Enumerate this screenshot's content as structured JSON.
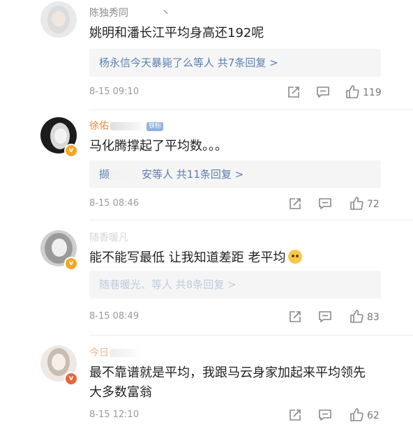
{
  "comments": [
    {
      "username": "陈独秀同",
      "username_suffix": "丶",
      "text": "姚明和潘长江平均身高还192呢",
      "reply_summary": "杨永信今天暴毙了么等人  共7条回复 >",
      "time": "8-15 09:10",
      "likes": "119"
    },
    {
      "username": "徐佑",
      "username_badge": "铁粉",
      "text": "马化腾撑起了平均数。。。",
      "reply_summary_a": "撷",
      "reply_summary_b": "安等人  共11条回复 >",
      "time": "8-15 08:46",
      "likes": "72"
    },
    {
      "username": "随香暖凡",
      "text": "能不能写最低 让我知道差距 老平均",
      "reply_summary": "随巷暖光、等人  共8条回复 >",
      "time": "8-15 08:49",
      "likes": "83"
    },
    {
      "username": "今日",
      "text_line1": "最不靠谱就是平均，我跟马云身家加起来平均领先",
      "text_line2": "大多数富翁",
      "time": "8-15 12:10",
      "likes": "62"
    }
  ],
  "icons": {
    "share": "share-icon",
    "comment": "comment-icon",
    "like": "thumbs-up-icon",
    "verified": "verified-badge-icon"
  },
  "colors": {
    "link_blue": "#5b7fb1",
    "username_gray": "#8a8a8a",
    "username_orange": "#e8893e",
    "meta_gray": "#9a9a9a",
    "reply_bg": "#f5f5f5",
    "verified_gold": "#f5a623"
  }
}
